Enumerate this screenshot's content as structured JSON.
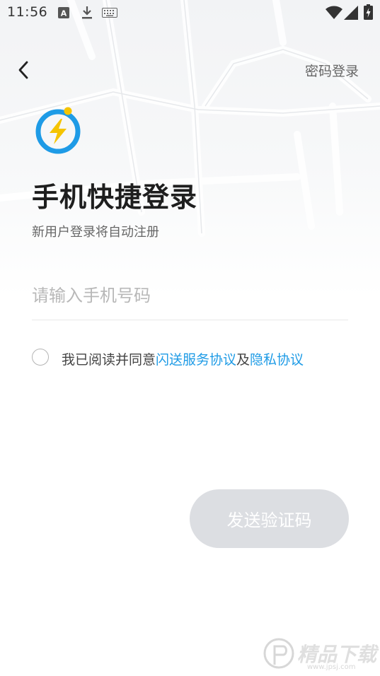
{
  "status_bar": {
    "time": "11:56"
  },
  "header": {
    "password_login": "密码登录"
  },
  "title": "手机快捷登录",
  "subtitle": "新用户登录将自动注册",
  "phone_input": {
    "placeholder": "请输入手机号码",
    "value": ""
  },
  "agreement": {
    "checked": false,
    "prefix": "我已阅读并同意",
    "service_link": "闪送服务协议",
    "connector": "及",
    "privacy_link": "隐私协议"
  },
  "send_code_button": "发送验证码",
  "watermark": {
    "text": "精品下载",
    "url": "www.jpsj.com"
  },
  "colors": {
    "link": "#1e9be6",
    "logo_ring": "#1e9be6",
    "logo_bolt": "#f5c400",
    "button_disabled": "#dcdee2"
  },
  "icons": [
    "back-chevron-icon",
    "logo-icon",
    "wifi-icon",
    "signal-icon",
    "battery-icon",
    "a-notification-icon",
    "download-icon",
    "keyboard-icon"
  ]
}
